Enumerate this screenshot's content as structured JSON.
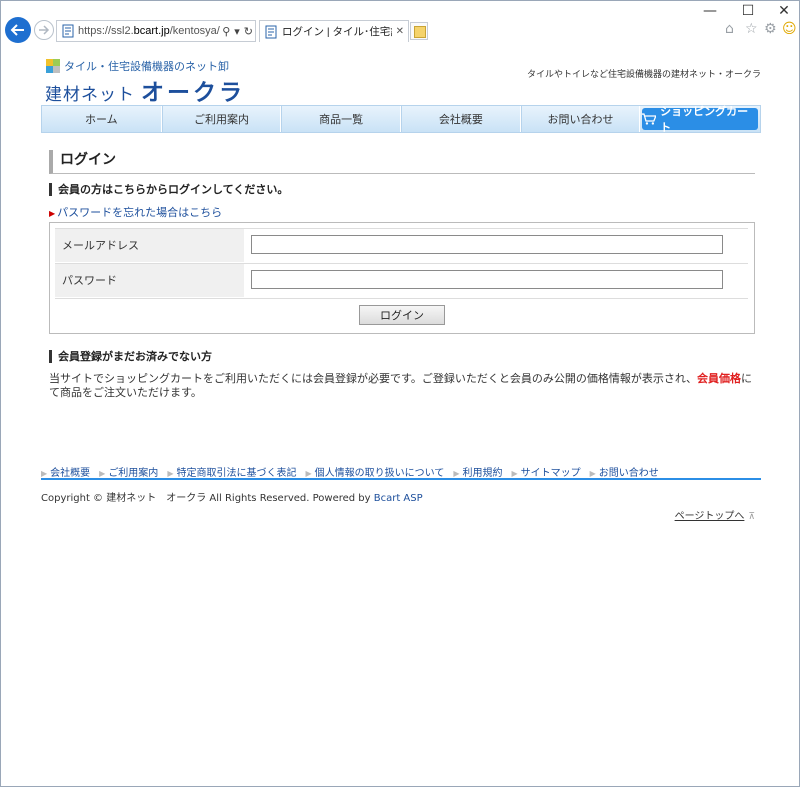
{
  "browser": {
    "url_prefix": "https://ssl2.",
    "url_domain": "bcart.jp",
    "url_rest": "/kentosya/k",
    "tab_title": "ログイン | タイル･住宅設備機...",
    "search_glyph": "⚲",
    "dropdown_glyph": "▾",
    "refresh_glyph": "↻",
    "close_glyph": "✕",
    "minimize_glyph": "—",
    "maximize_glyph": "☐",
    "home_glyph": "⌂",
    "favorites_glyph": "☆",
    "settings_glyph": "⚙",
    "smiley_glyph": "☺"
  },
  "header": {
    "tagline": "タイル・住宅設備機器のネット卸",
    "logo_line1": "建材ネット",
    "logo_line2": "オークラ",
    "right_text": "タイルやトイレなど住宅設備機器の建材ネット・オークラ"
  },
  "global_nav": {
    "items": [
      "ホーム",
      "ご利用案内",
      "商品一覧",
      "会社概要",
      "お問い合わせ"
    ],
    "cart_label": "ショッピングカート"
  },
  "login": {
    "heading": "ログイン",
    "member_heading": "会員の方はこちらからログインしてください。",
    "forgot_link": "パスワードを忘れた場合はこちら",
    "email_label": "メールアドレス",
    "email_value": "",
    "password_label": "パスワード",
    "password_value": "",
    "button_label": "ログイン"
  },
  "register": {
    "heading": "会員登録がまだお済みでない方",
    "text_before": "当サイトでショッピングカートをご利用いただくには会員登録が必要です。ご登録いただくと会員のみ公開の価格情報が表示され、",
    "text_red": "会員価格",
    "text_after": "にて商品をご注文いただけます。"
  },
  "footer": {
    "links": [
      "会社概要",
      "ご利用案内",
      "特定商取引法に基づく表記",
      "個人情報の取り扱いについて",
      "利用規約",
      "サイトマップ",
      "お問い合わせ"
    ],
    "copyright": "Copyright © 建材ネット　オークラ All Rights Reserved. Powered by ",
    "powered_link": "Bcart ASP",
    "page_top": "ページトップへ"
  }
}
